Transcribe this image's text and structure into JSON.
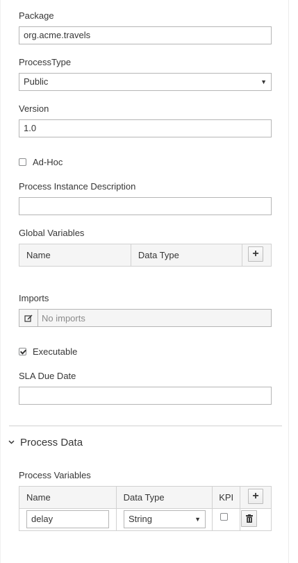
{
  "form": {
    "package": {
      "label": "Package",
      "value": "org.acme.travels"
    },
    "process_type": {
      "label": "ProcessType",
      "value": "Public"
    },
    "version": {
      "label": "Version",
      "value": "1.0"
    },
    "adhoc": {
      "label": "Ad-Hoc",
      "checked": false
    },
    "instance_description": {
      "label": "Process Instance Description",
      "value": ""
    },
    "global_variables": {
      "label": "Global Variables",
      "columns": [
        "Name",
        "Data Type"
      ]
    },
    "imports": {
      "label": "Imports",
      "value": "No imports"
    },
    "executable": {
      "label": "Executable",
      "checked": true
    },
    "sla_due_date": {
      "label": "SLA Due Date",
      "value": ""
    }
  },
  "process_data": {
    "section_title": "Process Data",
    "process_variables": {
      "label": "Process Variables",
      "columns": [
        "Name",
        "Data Type",
        "KPI"
      ],
      "rows": [
        {
          "name": "delay",
          "data_type": "String",
          "kpi": false
        }
      ]
    }
  }
}
